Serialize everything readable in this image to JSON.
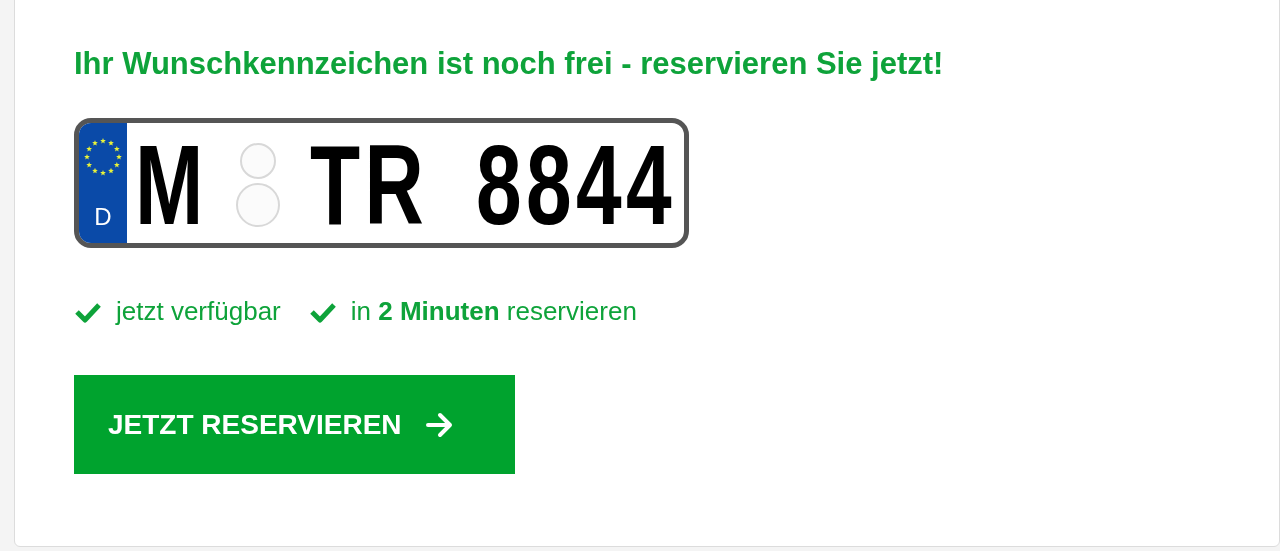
{
  "heading": "Ihr Wunschkennzeichen ist noch frei - reservieren Sie jetzt!",
  "plate": {
    "country": "D",
    "district": "M",
    "letters": "TR",
    "digits": "8844"
  },
  "features": [
    {
      "text": "jetzt verfügbar"
    },
    {
      "text": "in **2 Minuten** reservieren"
    }
  ],
  "button": {
    "label": "JETZT RESERVIEREN"
  }
}
